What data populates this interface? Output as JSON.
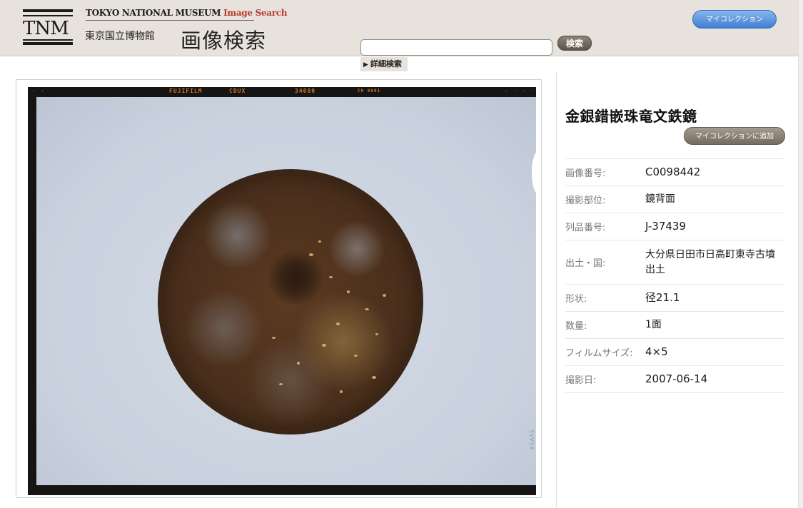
{
  "header": {
    "logo_text": "TNM",
    "english_title": "TOKYO NATIONAL MUSEUM",
    "english_title_accent": "Image Search",
    "org_name": "東京国立博物館",
    "app_title": "画像検索"
  },
  "search": {
    "value": "",
    "placeholder": "",
    "button_label": "検索",
    "advanced_label": "詳細検索"
  },
  "mycollection": {
    "label": "マイコレクション"
  },
  "film": {
    "brand": "FUJIFILM",
    "code": "CDUX",
    "number": "34080",
    "marker": "CH 0001",
    "side_code": "SVVSX"
  },
  "artifact": {
    "title": "金銀錯嵌珠竜文鉄鏡",
    "add_button_label": "マイコレクションに追加",
    "details": [
      {
        "key": "画像番号:",
        "value": "C0098442"
      },
      {
        "key": "撮影部位:",
        "value": "鏡背面"
      },
      {
        "key": "列品番号:",
        "value": "J-37439"
      },
      {
        "key": "出土・国:",
        "value": "大分県日田市日高町東寺古墳出土"
      },
      {
        "key": "形状:",
        "value": "径21.1"
      },
      {
        "key": "数量:",
        "value": "1面"
      },
      {
        "key": "フィルムサイズ:",
        "value": "4×5"
      },
      {
        "key": "撮影日:",
        "value": "2007-06-14"
      }
    ]
  },
  "colors": {
    "header_bg": "#e7e2dc",
    "accent_red": "#b83a2e",
    "mycollection_blue": "#3f7ed2",
    "button_brown": "#756b60"
  }
}
